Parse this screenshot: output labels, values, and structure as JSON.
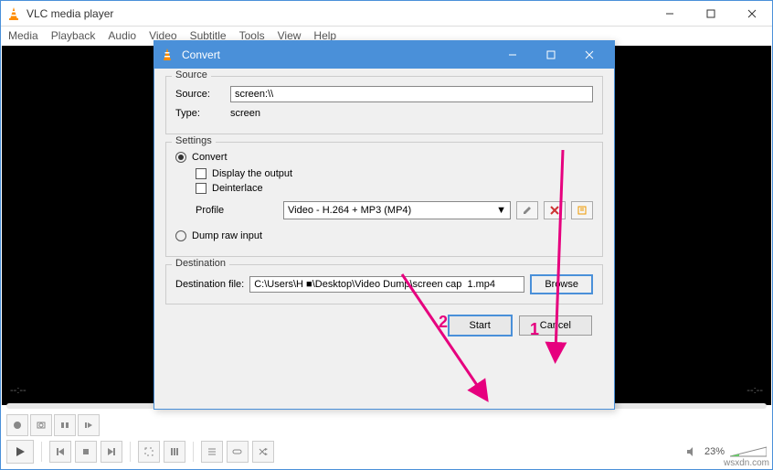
{
  "main": {
    "title": "VLC media player",
    "menu": [
      "Media",
      "Playback",
      "Audio",
      "Video",
      "Subtitle",
      "Tools",
      "View",
      "Help"
    ],
    "time_left": "--:--",
    "time_right": "--:--",
    "volume_pct": "23%"
  },
  "dialog": {
    "title": "Convert",
    "source": {
      "legend": "Source",
      "source_label": "Source:",
      "source_value": "screen:\\\\",
      "type_label": "Type:",
      "type_value": "screen"
    },
    "settings": {
      "legend": "Settings",
      "convert_label": "Convert",
      "display_output": "Display the output",
      "deinterlace": "Deinterlace",
      "profile_label": "Profile",
      "profile_value": "Video - H.264 + MP3 (MP4)",
      "dump_label": "Dump raw input"
    },
    "destination": {
      "legend": "Destination",
      "file_label": "Destination file:",
      "file_value": "C:\\Users\\H ■\\Desktop\\Video Dump\\screen cap  1.mp4",
      "browse": "Browse"
    },
    "buttons": {
      "start": "Start",
      "cancel": "Cancel"
    }
  },
  "annotations": {
    "num1": "1",
    "num2": "2"
  },
  "watermark": "wsxdn.com"
}
